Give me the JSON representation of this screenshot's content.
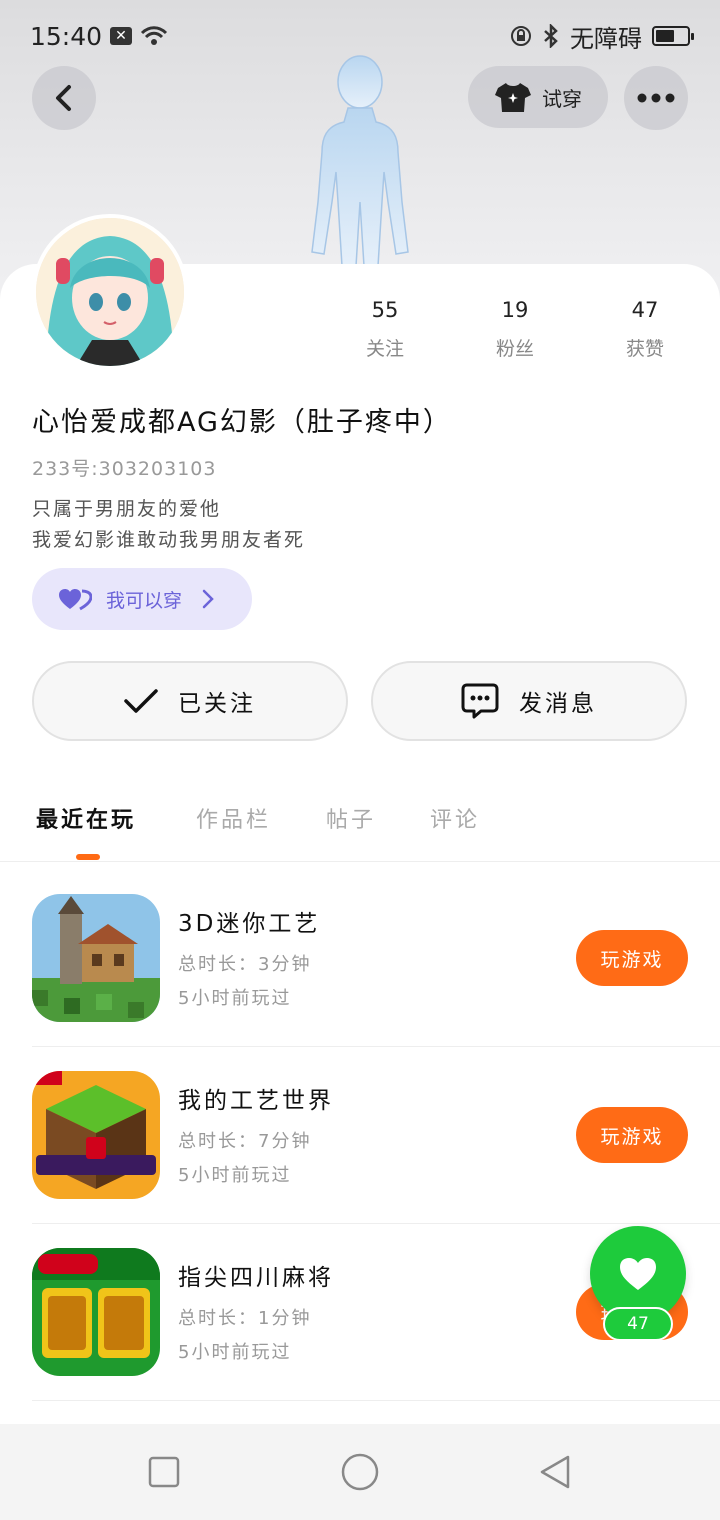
{
  "status_bar": {
    "time": "15:40",
    "accessibility_text": "无障碍"
  },
  "header": {
    "try_on_label": "试穿"
  },
  "profile": {
    "stats": [
      {
        "value": "55",
        "label": "关注"
      },
      {
        "value": "19",
        "label": "粉丝"
      },
      {
        "value": "47",
        "label": "获赞"
      }
    ],
    "nickname": "心怡爱成都AG幻影（肚子疼中）",
    "uid": "233号:303203103",
    "bio_line1": "只属于男朋友的爱他",
    "bio_line2": "我爱幻影谁敢动我男朋友者死",
    "tag_label": "我可以穿",
    "followed_label": "已关注",
    "message_label": "发消息"
  },
  "tabs": [
    "最近在玩",
    "作品栏",
    "帖子",
    "评论"
  ],
  "games": [
    {
      "name": "3D迷你工艺",
      "duration": "总时长：3分钟",
      "last_played": "5小时前玩过",
      "button": "玩游戏"
    },
    {
      "name": "我的工艺世界",
      "duration": "总时长：7分钟",
      "last_played": "5小时前玩过",
      "button": "玩游戏"
    },
    {
      "name": "指尖四川麻将",
      "duration": "总时长：1分钟",
      "last_played": "5小时前玩过",
      "button": "玩游戏"
    }
  ],
  "like_fab": {
    "count": "47"
  },
  "colors": {
    "accent_orange": "#ff6b16",
    "like_green": "#1ecb3c",
    "tag_purple": "#6b63d9"
  }
}
